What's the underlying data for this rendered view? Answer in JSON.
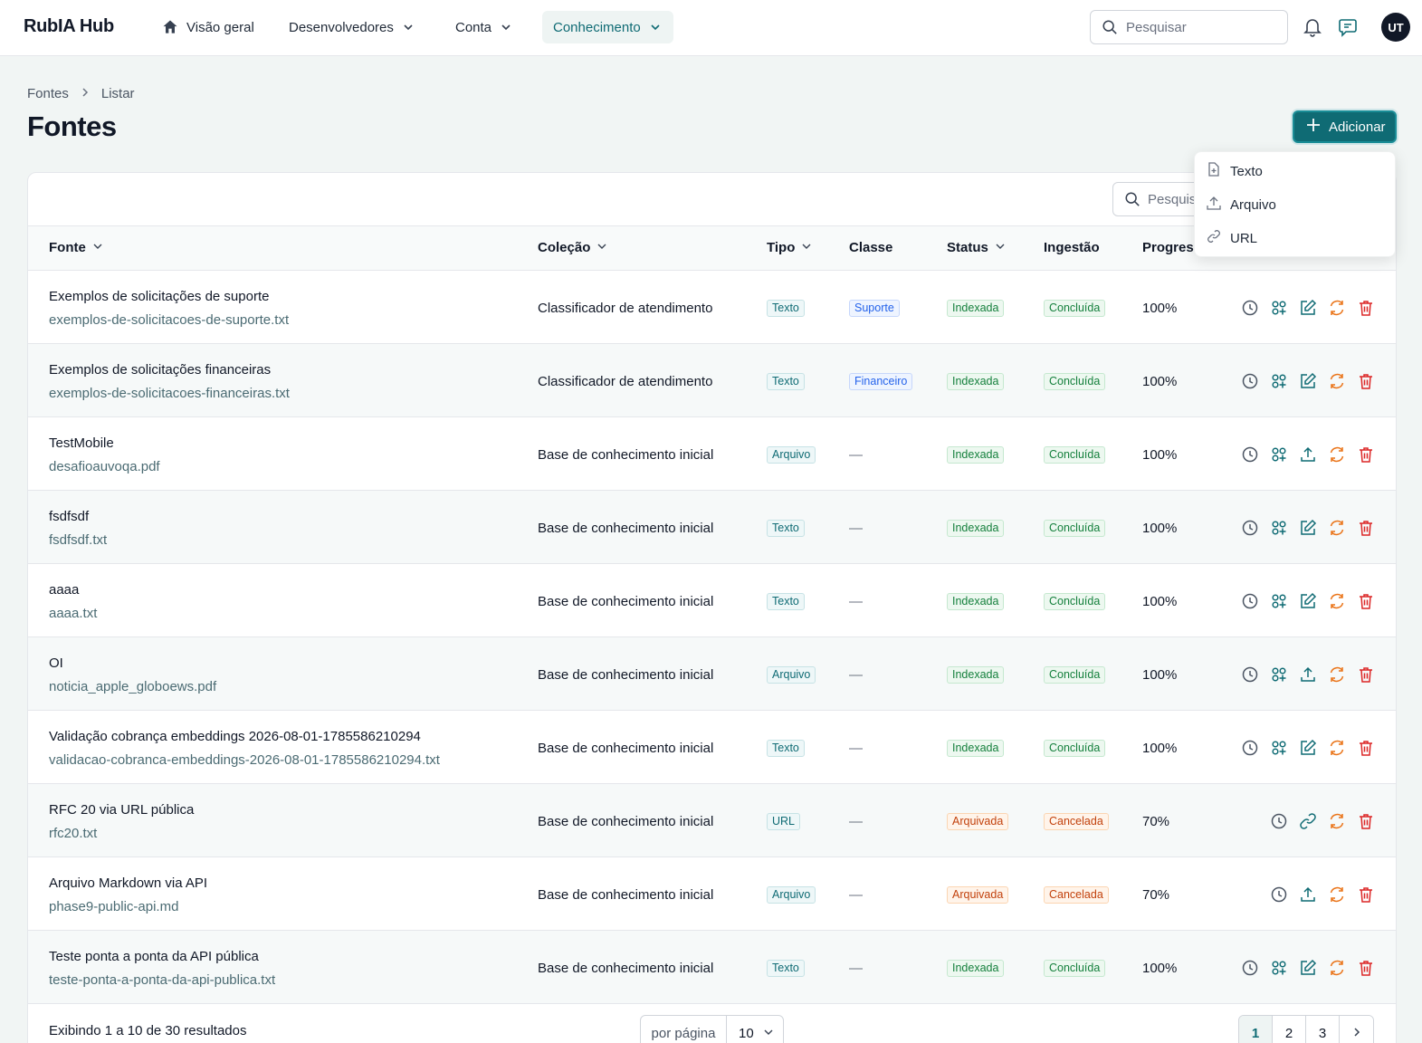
{
  "app": {
    "title": "RubIA Hub"
  },
  "nav": {
    "items": [
      {
        "label": "Visão geral"
      },
      {
        "label": "Desenvolvedores"
      },
      {
        "label": "Conta"
      },
      {
        "label": "Conhecimento"
      }
    ]
  },
  "top_search": {
    "placeholder": "Pesquisar"
  },
  "user": {
    "initials": "UT"
  },
  "breadcrumb": {
    "root": "Fontes",
    "current": "Listar"
  },
  "page": {
    "title": "Fontes"
  },
  "add_button": {
    "label": "Adicionar"
  },
  "add_menu": {
    "items": [
      {
        "label": "Texto",
        "icon": "file-plus-icon"
      },
      {
        "label": "Arquivo",
        "icon": "upload-icon"
      },
      {
        "label": "URL",
        "icon": "link-icon"
      }
    ]
  },
  "table_search": {
    "placeholder": "Pesquisar"
  },
  "table": {
    "headers": {
      "fonte": "Fonte",
      "colecao": "Coleção",
      "tipo": "Tipo",
      "classe": "Classe",
      "status": "Status",
      "ingestao": "Ingestão",
      "progresso": "Progress"
    },
    "rows": [
      {
        "name": "Exemplos de solicitações de suporte",
        "file": "exemplos-de-solicitacoes-de-suporte.txt",
        "collection": "Classificador de atendimento",
        "type": "Texto",
        "class": "Suporte",
        "status": "Indexada",
        "ingestion": "Concluída",
        "progress": "100%"
      },
      {
        "name": "Exemplos de solicitações financeiras",
        "file": "exemplos-de-solicitacoes-financeiras.txt",
        "collection": "Classificador de atendimento",
        "type": "Texto",
        "class": "Financeiro",
        "status": "Indexada",
        "ingestion": "Concluída",
        "progress": "100%"
      },
      {
        "name": "TestMobile",
        "file": "desafioauvoqa.pdf",
        "collection": "Base de conhecimento inicial",
        "type": "Arquivo",
        "class": "—",
        "status": "Indexada",
        "ingestion": "Concluída",
        "progress": "100%"
      },
      {
        "name": "fsdfsdf",
        "file": "fsdfsdf.txt",
        "collection": "Base de conhecimento inicial",
        "type": "Texto",
        "class": "—",
        "status": "Indexada",
        "ingestion": "Concluída",
        "progress": "100%"
      },
      {
        "name": "aaaa",
        "file": "aaaa.txt",
        "collection": "Base de conhecimento inicial",
        "type": "Texto",
        "class": "—",
        "status": "Indexada",
        "ingestion": "Concluída",
        "progress": "100%"
      },
      {
        "name": "OI",
        "file": "noticia_apple_globoews.pdf",
        "collection": "Base de conhecimento inicial",
        "type": "Arquivo",
        "class": "—",
        "status": "Indexada",
        "ingestion": "Concluída",
        "progress": "100%"
      },
      {
        "name": "Validação cobrança embeddings 2026-08-01-1785586210294",
        "file": "validacao-cobranca-embeddings-2026-08-01-1785586210294.txt",
        "collection": "Base de conhecimento inicial",
        "type": "Texto",
        "class": "—",
        "status": "Indexada",
        "ingestion": "Concluída",
        "progress": "100%"
      },
      {
        "name": "RFC 20 via URL pública",
        "file": "rfc20.txt",
        "collection": "Base de conhecimento inicial",
        "type": "URL",
        "class": "—",
        "status": "Arquivada",
        "ingestion": "Cancelada",
        "progress": "70%"
      },
      {
        "name": "Arquivo Markdown via API",
        "file": "phase9-public-api.md",
        "collection": "Base de conhecimento inicial",
        "type": "Arquivo",
        "class": "—",
        "status": "Arquivada",
        "ingestion": "Cancelada",
        "progress": "70%"
      },
      {
        "name": "Teste ponta a ponta da API pública",
        "file": "teste-ponta-a-ponta-da-api-publica.txt",
        "collection": "Base de conhecimento inicial",
        "type": "Texto",
        "class": "—",
        "status": "Indexada",
        "ingestion": "Concluída",
        "progress": "100%"
      }
    ]
  },
  "footer": {
    "info": "Exibindo 1 a 10 de 30 resultados",
    "per_page_label": "por página",
    "per_page_value": "10",
    "pages": [
      "1",
      "2",
      "3"
    ],
    "current_page": "1"
  },
  "colors": {
    "accent": "#0f6b74",
    "danger": "#dc2626",
    "warning": "#ea7317"
  }
}
